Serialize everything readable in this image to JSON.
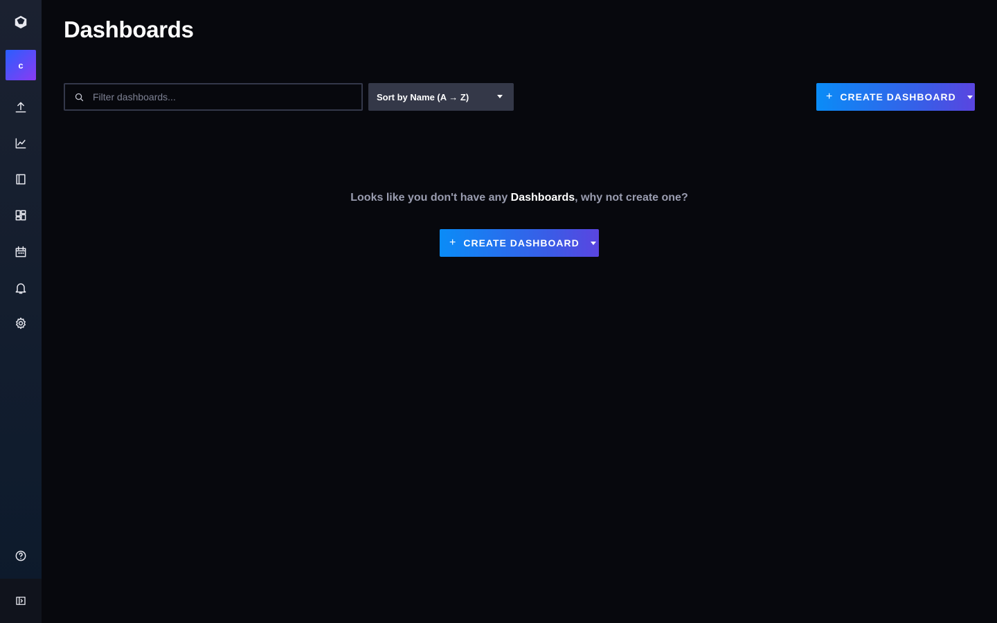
{
  "sidebar": {
    "org_initial": "c",
    "items": [
      {
        "name": "upload",
        "icon": "upload-icon"
      },
      {
        "name": "explore",
        "icon": "line-graph-icon"
      },
      {
        "name": "notebooks",
        "icon": "book-icon"
      },
      {
        "name": "dashboards",
        "icon": "dashboards-icon"
      },
      {
        "name": "tasks",
        "icon": "calendar-icon"
      },
      {
        "name": "alerts",
        "icon": "bell-icon"
      },
      {
        "name": "settings",
        "icon": "gear-icon"
      }
    ],
    "help_icon": "help-icon",
    "collapse_icon": "collapse-sidebar-icon"
  },
  "header": {
    "title": "Dashboards"
  },
  "toolbar": {
    "search_placeholder": "Filter dashboards...",
    "sort_label": "Sort by Name (A → Z)",
    "create_label": "CREATE DASHBOARD",
    "create_plus": "+"
  },
  "empty_state": {
    "prefix": "Looks like you don't have any ",
    "emphasis": "Dashboards",
    "suffix": ", why not create one?",
    "create_label": "CREATE DASHBOARD",
    "create_plus": "+"
  },
  "colors": {
    "background": "#07080d",
    "accent_start": "#0a8cf7",
    "accent_end": "#5a45e0"
  }
}
